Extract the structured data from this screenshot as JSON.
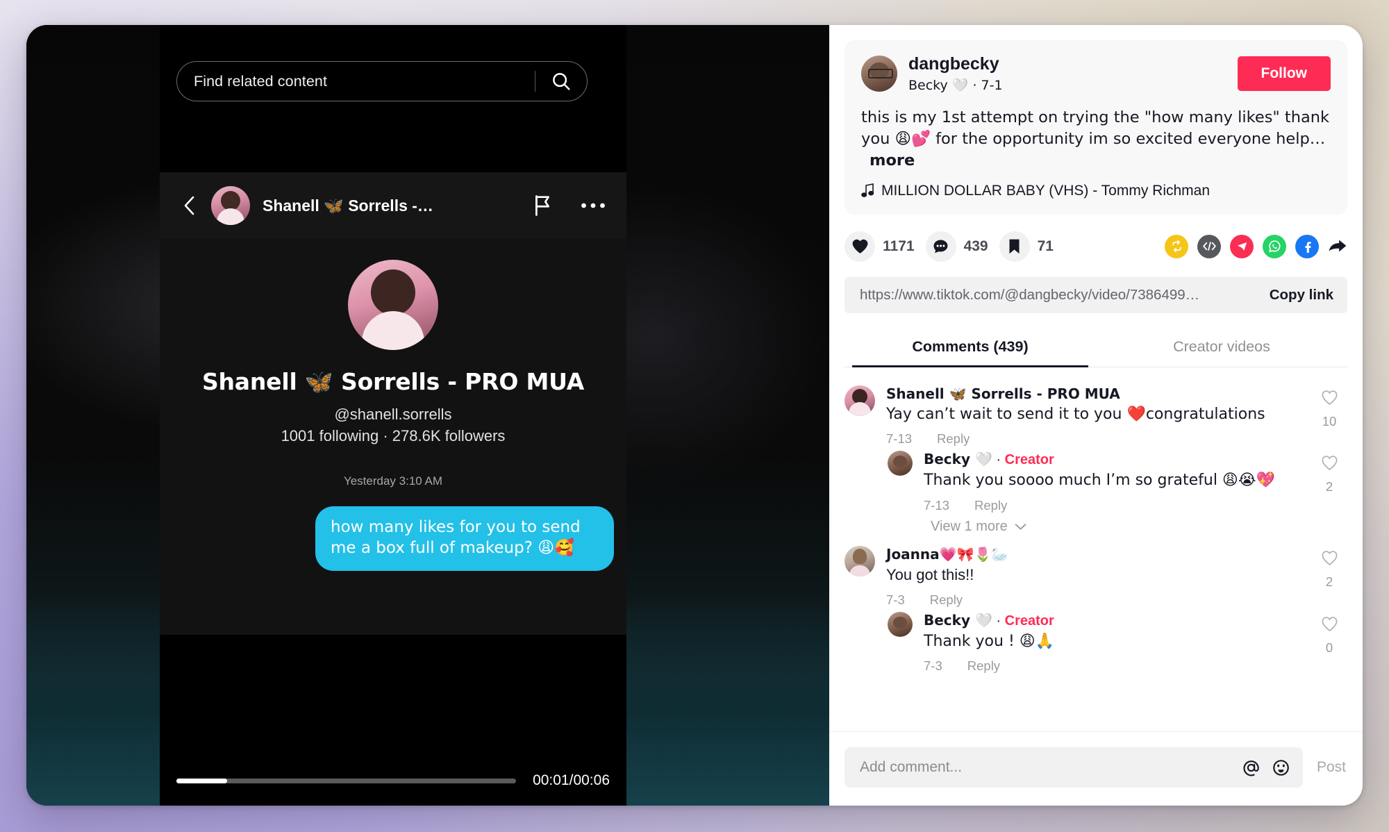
{
  "video_pane": {
    "search": {
      "placeholder": "Find related content",
      "icon": "search-icon"
    },
    "header": {
      "back_icon": "chevron-left-icon",
      "author_name": "Shanell 🦋 Sorrells -…",
      "flag_icon": "flag-icon",
      "more_icon": "more-horizontal-icon"
    },
    "profile": {
      "display_name": "Shanell 🦋 Sorrells - PRO MUA",
      "handle": "@shanell.sorrells",
      "stats": "1001 following · 278.6K followers"
    },
    "message": {
      "timestamp": "Yesterday 3:10 AM",
      "bubble_text": "how many likes for you to send me a box full of makeup? 😩🥰"
    },
    "player": {
      "time_label": "00:01/00:06",
      "progress_percent": 15
    }
  },
  "detail": {
    "author": {
      "username": "dangbecky",
      "subtitle": "Becky 🤍 · 7-1",
      "follow_label": "Follow"
    },
    "caption": {
      "text": "this is my 1st attempt on trying the \"how many likes\" thank you 😩💕 for the opportunity im so excited everyone help…",
      "more_label": "more"
    },
    "music": {
      "icon": "music-note-icon",
      "title": "MILLION DOLLAR BABY (VHS) - Tommy Richman"
    },
    "stats": [
      {
        "name": "like",
        "icon": "heart-icon",
        "count": "1171"
      },
      {
        "name": "comment",
        "icon": "comment-icon",
        "count": "439"
      },
      {
        "name": "bookmark",
        "icon": "bookmark-icon",
        "count": "71"
      }
    ],
    "share_icons": [
      {
        "name": "repost-icon",
        "color": "#f5c518",
        "glyph": "repost"
      },
      {
        "name": "embed-code-icon",
        "color": "#56585c",
        "glyph": "code"
      },
      {
        "name": "telegram-icon",
        "color": "#fa2e55",
        "glyph": "send"
      },
      {
        "name": "whatsapp-icon",
        "color": "#25d366",
        "glyph": "whatsapp"
      },
      {
        "name": "facebook-icon",
        "color": "#1877f2",
        "glyph": "facebook"
      },
      {
        "name": "share-arrow-icon",
        "color": "#161823",
        "glyph": "arrow"
      }
    ],
    "link": {
      "url": "https://www.tiktok.com/@dangbecky/video/7386499…",
      "copy_label": "Copy link"
    },
    "tabs": [
      {
        "label": "Comments (439)",
        "active": true
      },
      {
        "label": "Creator videos",
        "active": false
      }
    ],
    "comments": [
      {
        "name": "Shanell 🦋 Sorrells - PRO MUA",
        "text": "Yay can’t wait to send it to you ❤️congratulations",
        "date": "7-13",
        "reply_label": "Reply",
        "likes": "10",
        "is_creator": false,
        "is_reply": false
      },
      {
        "name": "Becky 🤍",
        "creator_badge": "Creator",
        "text": "Thank you soooo much I’m so grateful 😩😭💖",
        "date": "7-13",
        "reply_label": "Reply",
        "likes": "2",
        "is_creator": true,
        "is_reply": true
      },
      {
        "name": "Joanna💗🎀🌷🦢",
        "text": "You got this!!",
        "date": "7-3",
        "reply_label": "Reply",
        "likes": "2",
        "is_creator": false,
        "is_reply": false
      },
      {
        "name": "Becky 🤍",
        "creator_badge": "Creator",
        "text": "Thank you ! 😩🙏",
        "date": "7-3",
        "reply_label": "Reply",
        "likes": "0",
        "is_creator": true,
        "is_reply": true
      }
    ],
    "view_more_label": "View 1 more",
    "compose": {
      "placeholder": "Add comment...",
      "mention_icon": "at-mention-icon",
      "emoji_icon": "emoji-smiley-icon",
      "post_label": "Post"
    }
  }
}
